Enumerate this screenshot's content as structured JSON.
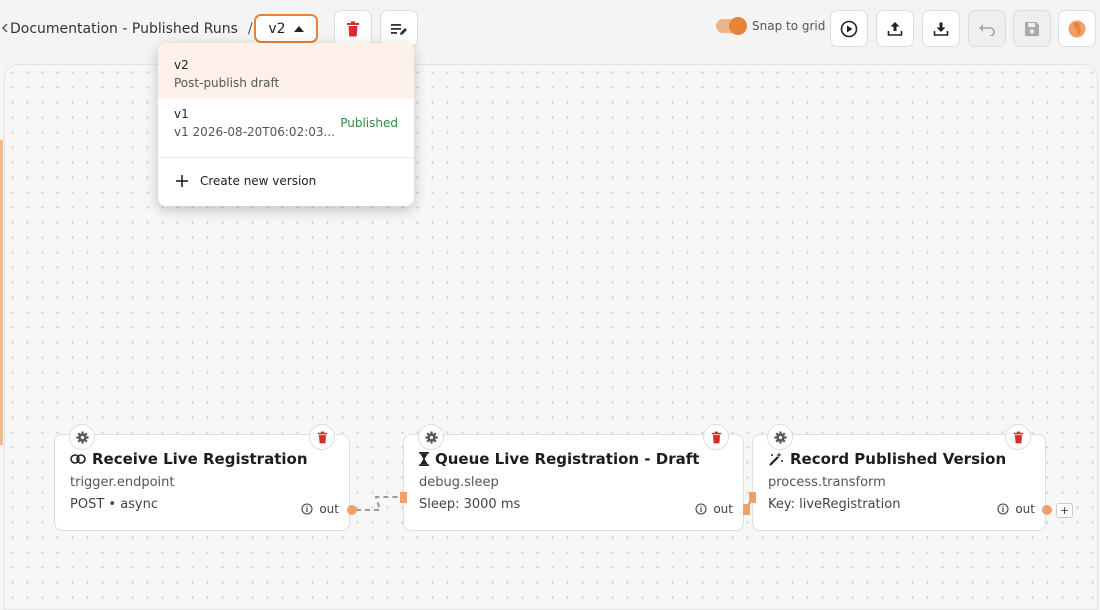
{
  "breadcrumb": {
    "title": "Documentation - Published Runs",
    "separator": "/"
  },
  "version_select": {
    "value": "v2"
  },
  "toolbar": {
    "snap_label": "Snap to grid",
    "snap_enabled": true
  },
  "dropdown": {
    "options": [
      {
        "name": "v2",
        "subtitle": "Post-publish draft",
        "badge": ""
      },
      {
        "name": "v1",
        "subtitle": "v1 2026-08-20T06:02:03...",
        "badge": "Published"
      }
    ],
    "create_label": "Create new version"
  },
  "nodes": [
    {
      "title": "Receive Live Registration",
      "type": "trigger.endpoint",
      "detail": "POST • async",
      "out": "out",
      "icon": "link-icon"
    },
    {
      "title": "Queue Live Registration - Draft",
      "type": "debug.sleep",
      "detail": "Sleep: 3000 ms",
      "out": "out",
      "icon": "hourglass-icon"
    },
    {
      "title": "Record Published Version",
      "type": "process.transform",
      "detail": "Key: liveRegistration",
      "out": "out",
      "icon": "magic-wand-icon"
    }
  ],
  "add_button": "+",
  "colors": {
    "accent": "#e7823a",
    "delete": "#d32f2f",
    "published": "#2e8b3e"
  }
}
